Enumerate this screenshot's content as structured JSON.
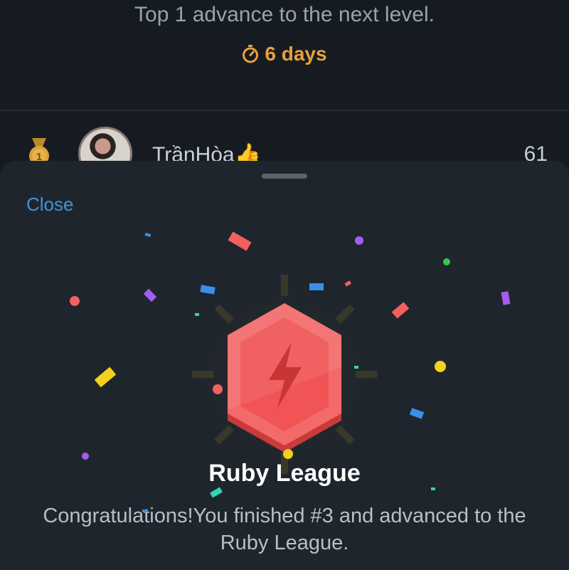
{
  "leaderboard": {
    "advance_text": "Top 1 advance to the next level.",
    "timer_text": "6 days",
    "timer_color": "#e8a13a",
    "rows": [
      {
        "rank": "1",
        "name": "TrầnHòa👍",
        "score": "61"
      }
    ]
  },
  "sheet": {
    "close_label": "Close",
    "league_title": "Ruby League",
    "league_description": "Congratulations!You finished #3 and advanced to the Ruby League.",
    "badge_icon": "lightning-bolt-icon",
    "badge_color": "#f25a5a"
  },
  "colors": {
    "background": "#161b22",
    "sheet": "#1f252d",
    "link": "#3f94d9"
  }
}
